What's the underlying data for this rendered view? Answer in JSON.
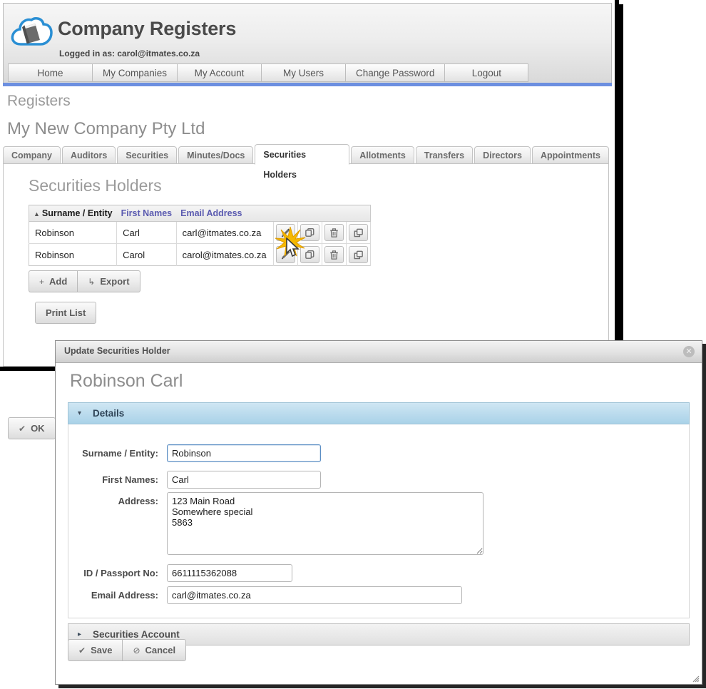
{
  "header": {
    "app_title": "Company Registers",
    "logged_in_label": "Logged in as: carol@itmates.co.za",
    "logo_icon": "cloud-book-logo",
    "accent_bar_color": "#6c8fe0",
    "nav": [
      {
        "label": "Home"
      },
      {
        "label": "My Companies"
      },
      {
        "label": "My Account"
      },
      {
        "label": "My Users"
      },
      {
        "label": "Change Password"
      },
      {
        "label": "Logout"
      }
    ]
  },
  "page": {
    "breadcrumb": "Registers",
    "company_name": "My New Company Pty Ltd",
    "tabs": [
      {
        "label": "Company",
        "active": false
      },
      {
        "label": "Auditors",
        "active": false
      },
      {
        "label": "Securities",
        "active": false
      },
      {
        "label": "Minutes/Docs",
        "active": false
      },
      {
        "label": "Securities Holders",
        "active": true
      },
      {
        "label": "Allotments",
        "active": false
      },
      {
        "label": "Transfers",
        "active": false
      },
      {
        "label": "Directors",
        "active": false
      },
      {
        "label": "Appointments",
        "active": false
      }
    ],
    "panel_title": "Securities Holders",
    "table": {
      "sort_indicator": "▲",
      "columns": [
        {
          "label": "Surname / Entity",
          "sorted": true
        },
        {
          "label": "First Names",
          "sorted": false
        },
        {
          "label": "Email Address",
          "sorted": false
        }
      ],
      "rows": [
        {
          "surname": "Robinson",
          "first_names": "Carl",
          "email": "carl@itmates.co.za"
        },
        {
          "surname": "Robinson",
          "first_names": "Carol",
          "email": "carol@itmates.co.za"
        }
      ],
      "row_actions": [
        "edit-icon",
        "copy-icon",
        "delete-icon",
        "open-window-icon"
      ]
    },
    "buttons": {
      "add_label": "Add",
      "add_glyph": "+",
      "export_label": "Export",
      "export_glyph": "↳",
      "print_label": "Print List",
      "ok_label": "OK",
      "ok_glyph": "✔"
    }
  },
  "modal": {
    "title": "Update Securities Holder",
    "close_glyph": "✕",
    "heading": "Robinson Carl",
    "sections": [
      {
        "label": "Details",
        "expanded": true,
        "arrow": "▾"
      },
      {
        "label": "Securities Account",
        "expanded": false,
        "arrow": "▸"
      }
    ],
    "fields": [
      {
        "label": "Surname / Entity:",
        "value": "Robinson",
        "focused": true
      },
      {
        "label": "First Names:",
        "value": "Carl",
        "focused": false
      },
      {
        "label": "Address:",
        "value": "123 Main Road\nSomewhere special\n5863",
        "focused": false
      },
      {
        "label": "ID / Passport No:",
        "value": "6611115362088",
        "focused": false
      },
      {
        "label": "Email Address:",
        "value": "carl@itmates.co.za",
        "focused": false
      }
    ],
    "footer": {
      "save_label": "Save",
      "save_glyph": "✔",
      "cancel_label": "Cancel",
      "cancel_glyph": "⊘"
    }
  },
  "cursor": {
    "click_effect": "star-burst",
    "burst_color": "#f5b800"
  }
}
